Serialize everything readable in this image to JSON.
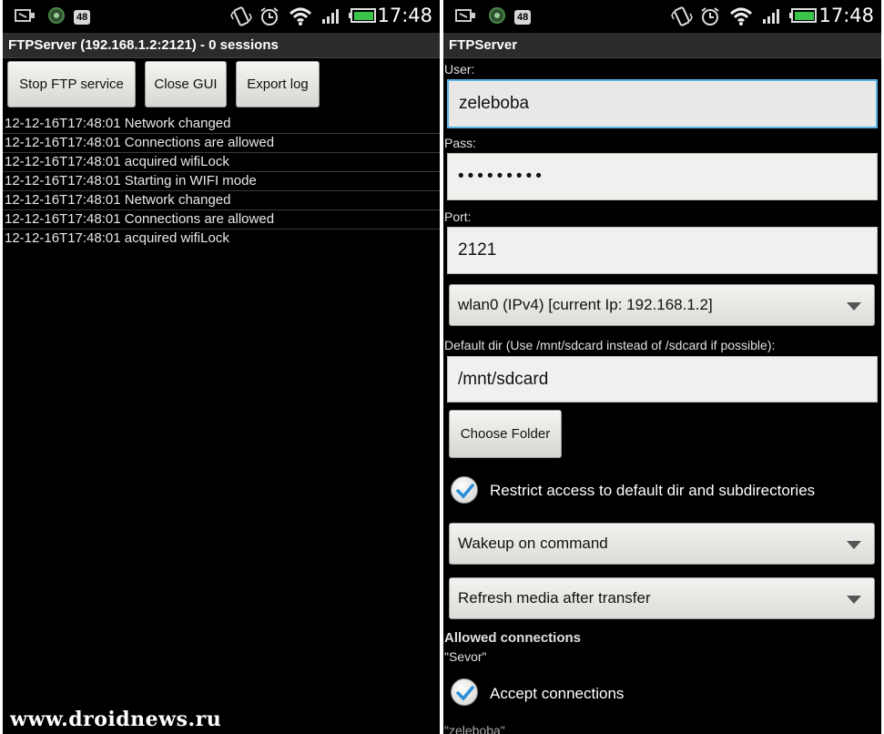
{
  "status_bar": {
    "time": "17:48",
    "notification_badge": "48",
    "icons": [
      "usb-debug-icon",
      "sync-icon",
      "battery-count-badge",
      "vibrate-icon",
      "alarm-icon",
      "wifi-icon",
      "signal-icon",
      "battery-icon"
    ]
  },
  "left_screen": {
    "title": "FTPServer (192.168.1.2:2121) - 0 sessions",
    "buttons": {
      "stop": "Stop FTP service",
      "close": "Close GUI",
      "export": "Export log"
    },
    "log": [
      "12-12-16T17:48:01 Network changed",
      "12-12-16T17:48:01 Connections are allowed",
      "12-12-16T17:48:01 acquired wifiLock",
      "12-12-16T17:48:01 Starting in WIFI mode",
      "12-12-16T17:48:01 Network changed",
      "12-12-16T17:48:01 Connections are allowed",
      "12-12-16T17:48:01 acquired wifiLock"
    ]
  },
  "right_screen": {
    "title": "FTPServer",
    "user_label": "User:",
    "user_value": "zeleboba",
    "pass_label": "Pass:",
    "pass_value": "•••••••••",
    "port_label": "Port:",
    "port_value": "2121",
    "interface_select": "wlan0 (IPv4) [current Ip: 192.168.1.2]",
    "default_dir_label": "Default dir (Use /mnt/sdcard instead of /sdcard if possible):",
    "default_dir_value": "/mnt/sdcard",
    "choose_folder": "Choose Folder",
    "restrict_label": "Restrict access to default dir and subdirectories",
    "wakeup_select": "Wakeup on command",
    "refresh_select": "Refresh media after transfer",
    "allowed_header": "Allowed connections",
    "allowed_entry": "\"Sevor\"",
    "accept_label": "Accept connections",
    "cut_off_entry": "\"zeleboba\""
  },
  "watermark": "www.droidnews.ru",
  "colors": {
    "focus_border": "#5ab4e8",
    "check_mark": "#2a8fd8",
    "background": "#000000"
  }
}
